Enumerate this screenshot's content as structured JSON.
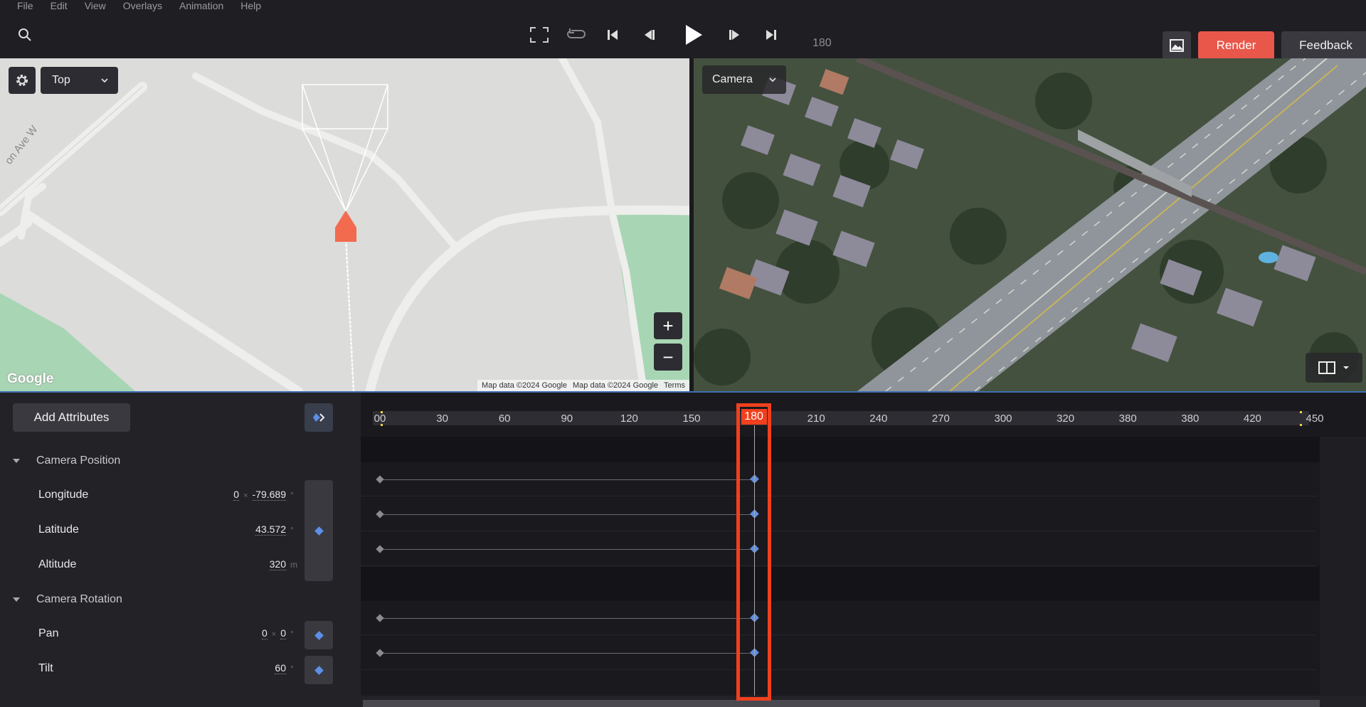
{
  "menu": [
    "File",
    "Edit",
    "View",
    "Overlays",
    "Animation",
    "Help"
  ],
  "toolbar": {
    "icons": [
      "search-icon",
      "fullscreen-icon",
      "loop-icon",
      "skip-to-start-icon",
      "step-back-icon",
      "play-icon",
      "step-forward-icon",
      "skip-to-end-icon"
    ],
    "current_frame": "180",
    "render_label": "Render",
    "feedback_label": "Feedback",
    "accent_color": "#e8574a"
  },
  "map_view": {
    "view_select": "Top",
    "street_label": "on Ave W",
    "logo": "Google",
    "attribution": [
      "Map data ©2024 Google",
      "Map data ©2024 Google",
      "Terms"
    ],
    "zoom_in": "+",
    "zoom_out": "−"
  },
  "camera_view": {
    "view_select": "Camera"
  },
  "attributes": {
    "add_button": "Add Attributes",
    "groups": [
      {
        "label": "Camera Position",
        "rows": [
          {
            "label": "Longitude",
            "values": [
              "0",
              "-79.689"
            ],
            "unit": "°"
          },
          {
            "label": "Latitude",
            "values": [
              "43.572"
            ],
            "unit": "°"
          },
          {
            "label": "Altitude",
            "values": [
              "320"
            ],
            "unit": "m"
          }
        ]
      },
      {
        "label": "Camera Rotation",
        "rows": [
          {
            "label": "Pan",
            "values": [
              "0",
              "0"
            ],
            "unit": "°"
          },
          {
            "label": "Tilt",
            "values": [
              "60"
            ],
            "unit": "°"
          }
        ]
      }
    ]
  },
  "timeline": {
    "ticks": [
      "00",
      "30",
      "60",
      "90",
      "120",
      "150",
      "180",
      "210",
      "240",
      "270",
      "300",
      "320",
      "380",
      "380",
      "420",
      "450"
    ],
    "playhead_frame": "180",
    "playhead_color": "#f0401e",
    "keyframe_color": "#5c8fe6"
  }
}
